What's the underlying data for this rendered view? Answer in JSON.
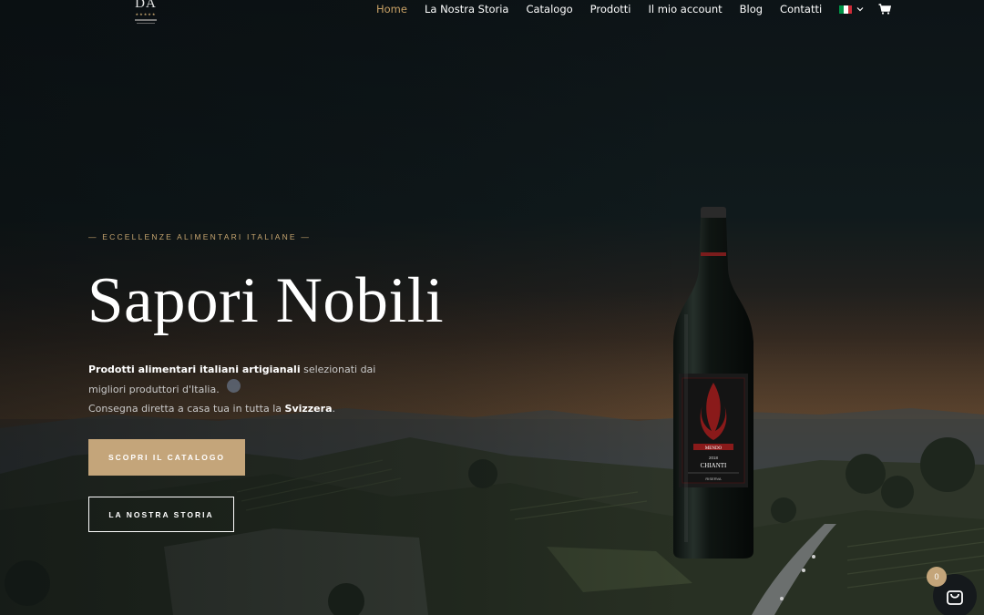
{
  "header": {
    "logo_text": "DA",
    "logo_stars": "★★★★★",
    "nav": [
      {
        "label": "Home",
        "active": true
      },
      {
        "label": "La Nostra Storia",
        "active": false
      },
      {
        "label": "Catalogo",
        "active": false
      },
      {
        "label": "Prodotti",
        "active": false
      },
      {
        "label": "Il mio account",
        "active": false
      },
      {
        "label": "Blog",
        "active": false
      },
      {
        "label": "Contatti",
        "active": false
      }
    ],
    "language": {
      "flag_colors": [
        "#009246",
        "#ffffff",
        "#ce2b37"
      ],
      "icon": "italy-flag-icon"
    },
    "cart_icon": "cart-icon"
  },
  "hero": {
    "eyebrow": "— ECCELLENZE ALIMENTARI ITALIANE —",
    "title": "Sapori Nobili",
    "text_bold_1": "Prodotti alimentari italiani artigianali",
    "text_1": " selezionati dai migliori produttori d'Italia.",
    "text_2": "Consegna diretta a casa tua in tutta la ",
    "text_bold_2": "Svizzera",
    "text_3": ".",
    "primary_button": "SCOPRI IL CATALOGO",
    "secondary_button": "LA NOSTRA STORIA"
  },
  "bottle": {
    "brand": "MENDO",
    "year": "2018",
    "name": "CHIANTI",
    "subtitle": "RISERVA"
  },
  "floating_cart": {
    "count": "0",
    "icon": "shopping-bag-icon"
  },
  "colors": {
    "accent": "#c4a57a",
    "nav_active": "#c8a165",
    "background": "#0c1518"
  }
}
